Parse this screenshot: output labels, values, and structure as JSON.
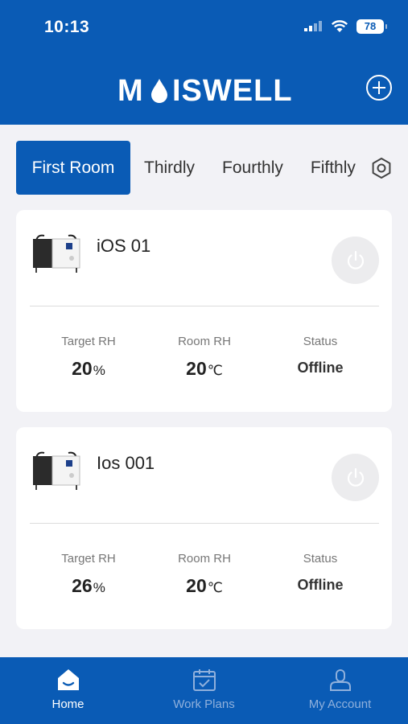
{
  "status_bar": {
    "time": "10:13",
    "battery": "78"
  },
  "header": {
    "brand": "MOISWELL"
  },
  "tabs": [
    {
      "label": "First Room"
    },
    {
      "label": "Thirdly"
    },
    {
      "label": "Fourthly"
    },
    {
      "label": "Fifthly"
    }
  ],
  "devices": [
    {
      "name": "iOS 01",
      "target_rh_label": "Target RH",
      "target_rh_value": "20",
      "target_rh_unit": "%",
      "room_rh_label": "Room RH",
      "room_rh_value": "20",
      "room_rh_unit": "℃",
      "status_label": "Status",
      "status_value": "Offline"
    },
    {
      "name": "Ios 001",
      "target_rh_label": "Target RH",
      "target_rh_value": "26",
      "target_rh_unit": "%",
      "room_rh_label": "Room RH",
      "room_rh_value": "20",
      "room_rh_unit": "℃",
      "status_label": "Status",
      "status_value": "Offline"
    }
  ],
  "nav": [
    {
      "label": "Home",
      "icon": "home-icon"
    },
    {
      "label": "Work Plans",
      "icon": "calendar-icon"
    },
    {
      "label": "My Account",
      "icon": "user-icon"
    }
  ],
  "colors": {
    "brand": "#0a5bb5",
    "background": "#f2f2f6",
    "inactive_nav": "#8fb0dc"
  }
}
